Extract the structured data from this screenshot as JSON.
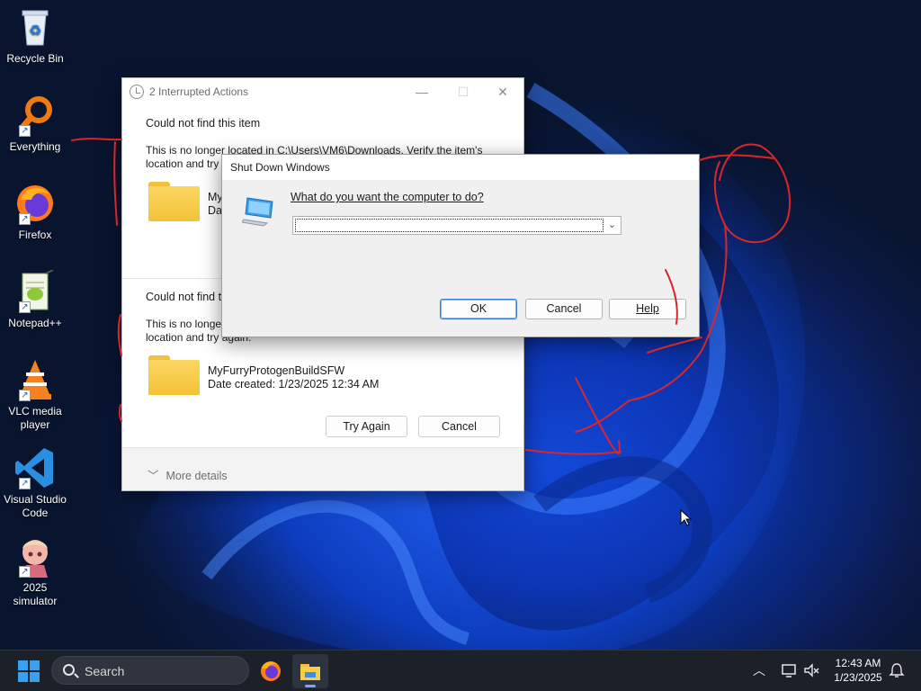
{
  "desktop": {
    "icons": [
      {
        "label": "Recycle Bin",
        "icon": "recycle-bin-icon"
      },
      {
        "label": "Everything",
        "icon": "everything-search-icon"
      },
      {
        "label": "Firefox",
        "icon": "firefox-icon"
      },
      {
        "label": "Notepad++",
        "icon": "notepad-plus-plus-icon"
      },
      {
        "label": "VLC media player",
        "icon": "vlc-icon"
      },
      {
        "label": "Visual Studio Code",
        "icon": "vscode-icon"
      },
      {
        "label": "2025 simulator",
        "icon": "anime-character-icon"
      }
    ]
  },
  "interrupted_dialog": {
    "title": "2 Interrupted Actions",
    "items": [
      {
        "heading": "Could not find this item",
        "message_line1": "This is no longer located in C:\\Users\\VM6\\Downloads. Verify the item's",
        "message_line2": "location and try again.",
        "file_name": "My",
        "file_date": "Date"
      },
      {
        "heading": "Could not find t",
        "message_line1": "This is no longe",
        "message_line2": "location and try again.",
        "file_name": "MyFurryProtogenBuildSFW",
        "file_date": "Date created: 1/23/2025 12:34 AM"
      }
    ],
    "try_again_label": "Try Again",
    "cancel_label": "Cancel",
    "more_details_label": "More details"
  },
  "shutdown_dialog": {
    "title": "Shut Down Windows",
    "question": "What do you want the computer to do?",
    "selected_option": "",
    "ok_label": "OK",
    "cancel_label": "Cancel",
    "help_label": "Help"
  },
  "taskbar": {
    "search_placeholder": "Search",
    "time": "12:43 AM",
    "date": "1/23/2025",
    "pinned_apps": [
      "firefox-icon",
      "file-explorer-icon"
    ]
  },
  "colors": {
    "accent_blue": "#3aa0f0",
    "scribble_red": "#d9262c",
    "taskbar_bg": "#1c2029"
  }
}
